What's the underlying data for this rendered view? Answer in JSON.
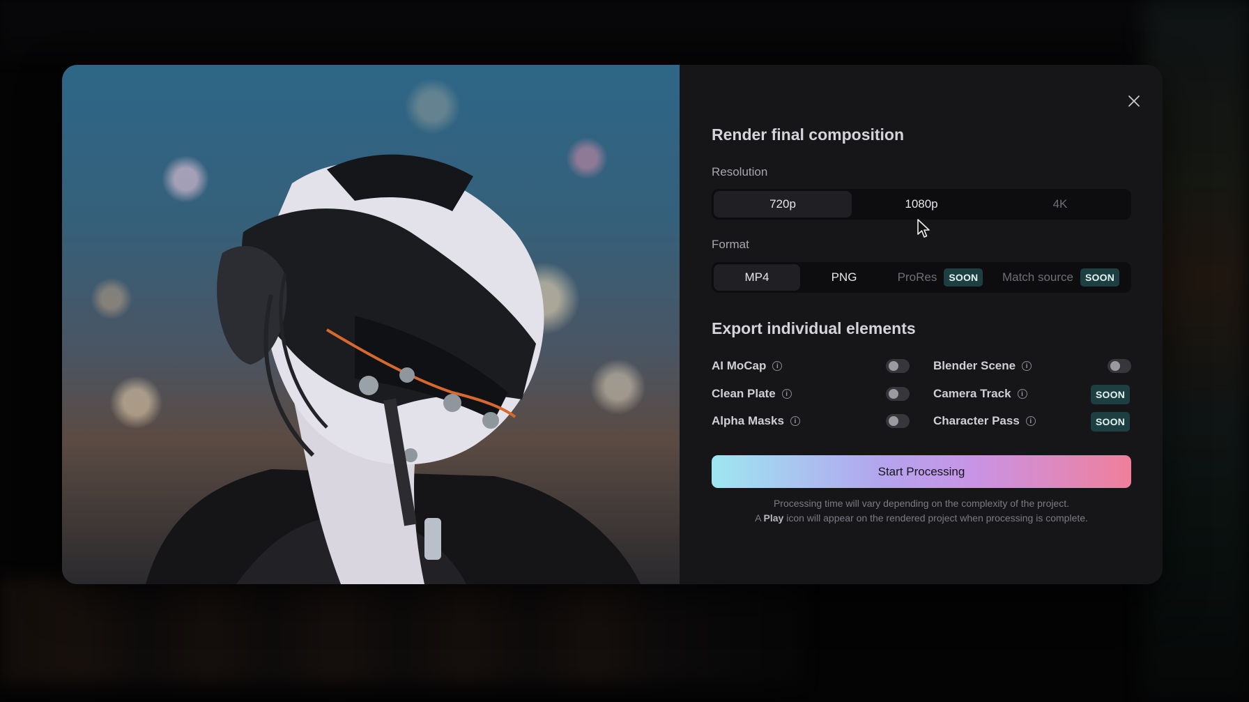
{
  "dialog": {
    "title": "Render final composition",
    "resolution": {
      "label": "Resolution",
      "options": [
        {
          "label": "720p",
          "state": "selected"
        },
        {
          "label": "1080p",
          "state": "enabled"
        },
        {
          "label": "4K",
          "state": "disabled"
        }
      ]
    },
    "format": {
      "label": "Format",
      "options": [
        {
          "label": "MP4",
          "state": "selected"
        },
        {
          "label": "PNG",
          "state": "enabled"
        },
        {
          "label": "ProRes",
          "state": "disabled",
          "badge": "SOON"
        },
        {
          "label": "Match source",
          "state": "disabled",
          "badge": "SOON"
        }
      ]
    },
    "export": {
      "title": "Export individual elements",
      "items": [
        {
          "label": "AI MoCap",
          "toggle": false
        },
        {
          "label": "Blender Scene",
          "toggle": false
        },
        {
          "label": "Clean Plate",
          "toggle": false
        },
        {
          "label": "Camera Track",
          "badge": "SOON"
        },
        {
          "label": "Alpha Masks",
          "toggle": false
        },
        {
          "label": "Character Pass",
          "badge": "SOON"
        }
      ]
    },
    "cta_label": "Start Processing",
    "note_line1": "Processing time will vary depending on the complexity of the project.",
    "note_line2_prefix": "A",
    "note_line2_bold": "Play",
    "note_line2_suffix": "icon will appear on the rendered project when processing is complete."
  },
  "icons": {
    "close": "close-icon",
    "info": "info-icon",
    "cursor": "mouse-pointer-icon"
  },
  "colors": {
    "modal_bg": "#161619",
    "segment_bg": "#0d0d0f",
    "segment_active": "#202024",
    "soon_badge": "#1d3f42",
    "cta_gradient_start": "#9ee6f1",
    "cta_gradient_end": "#f07f9b"
  }
}
